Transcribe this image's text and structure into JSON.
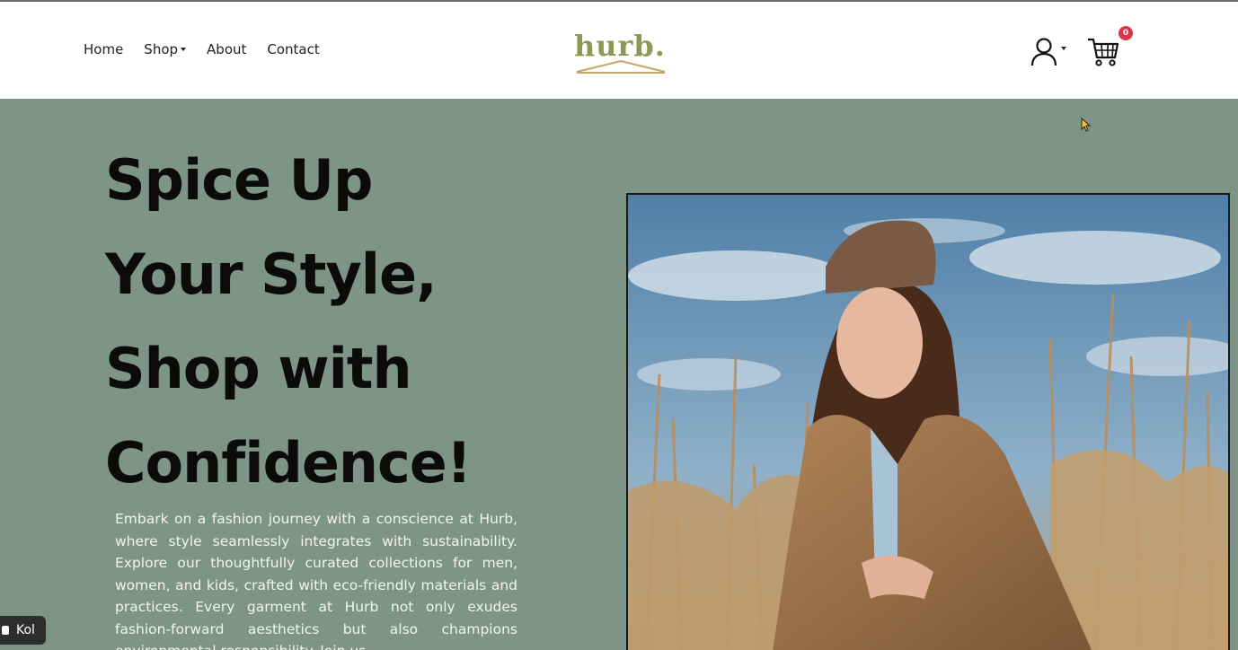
{
  "nav": {
    "home": "Home",
    "shop": "Shop",
    "about": "About",
    "contact": "Contact"
  },
  "brand": {
    "logo_text": "hurb.",
    "logo_color": "#8a9a54",
    "accent_underline": "#c9a56b"
  },
  "header_icons": {
    "account": "user-icon",
    "cart": "cart-icon",
    "cart_count": "0"
  },
  "hero": {
    "headline_lines": [
      "Spice Up",
      "Your Style,",
      "Shop with",
      "Confidence!"
    ],
    "body": "Embark on a fashion journey with a conscience at Hurb, where style seamlessly integrates with sustainability. Explore our thoughtfully curated collections for men, women, and kids, crafted with eco-friendly materials and practices. Every garment at Hurb not only exudes fashion-forward aesthetics but also champions environmental responsibility. Join us",
    "background_color": "#7e9487"
  },
  "overlay": {
    "kol_label": "Kol"
  }
}
